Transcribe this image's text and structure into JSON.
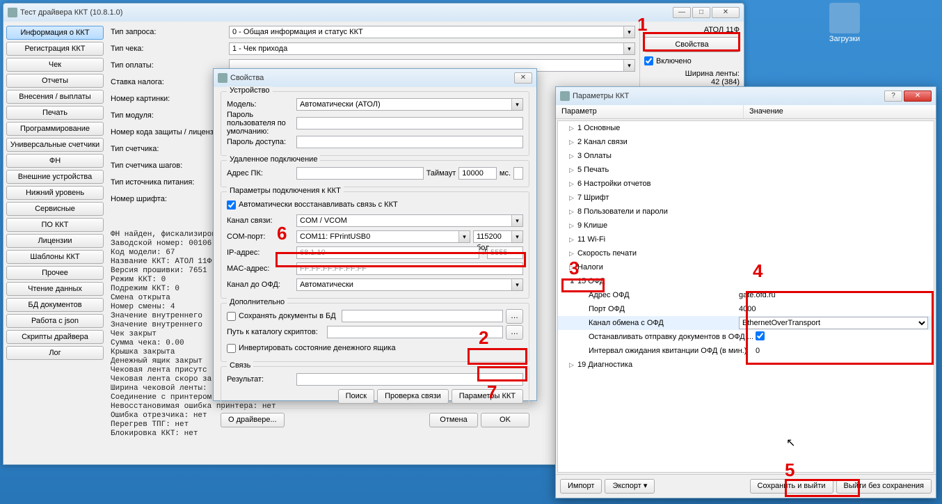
{
  "desktop": {
    "downloads": "Загрузки"
  },
  "main": {
    "title": "Тест драйвера ККТ (10.8.1.0)",
    "sidebar": [
      "Информация о ККТ",
      "Регистрация ККТ",
      "Чек",
      "Отчеты",
      "Внесения / выплаты",
      "Печать",
      "Программирование",
      "Универсальные счетчики",
      "ФН",
      "Внешние устройства",
      "Нижний уровень",
      "Сервисные",
      "ПО ККТ",
      "Лицензии",
      "Шаблоны ККТ",
      "Прочее",
      "Чтение данных",
      "БД документов",
      "Работа с json",
      "Скрипты драйвера",
      "Лог"
    ],
    "fields": {
      "req_type_l": "Тип запроса:",
      "req_type_v": "0 - Общая информация и статус ККТ",
      "rec_type_l": "Тип чека:",
      "rec_type_v": "1 - Чек прихода",
      "pay_type_l": "Тип оплаты:",
      "tax_l": "Ставка налога:",
      "pic_num_l": "Номер картинки:",
      "mod_type_l": "Тип модуля:",
      "lic_l": "Номер кода защиты / лицензии",
      "cnt_type_l": "Тип счетчика:",
      "step_cnt_l": "Тип счетчика шагов:",
      "pwr_l": "Тип источника питания:",
      "font_l": "Номер шрифта:"
    },
    "log": "ФН найден, фискализирован\nЗаводской номер: 00106\nКод модели: 67\nНазвание ККТ: АТОЛ 11Ф\nВерсия прошивки: 7651\nРежим ККТ: 0\nПодрежим ККТ: 0\nСмена открыта\nНомер смены: 4\nЗначение внутреннего\nЗначение внутреннего\nЧек закрыт\nСумма чека: 0.00\nКрышка закрыта\nДенежный ящик закрыт\nЧековая лента присутс\nЧековая лента скоро за\nШирина чековой ленты:\nСоединение с принтером\nНевосстановимая ошибка принтера: нет\nОшибка отрезчика: нет\nПерегрев ТПГ: нет\nБлокировка ККТ: нет",
    "right": {
      "model": "АТОЛ 11Ф",
      "props_btn": "Свойства",
      "enabled": "Включено",
      "tape_l": "Ширина ленты:",
      "tape_v": "42 (384)"
    }
  },
  "dlg1": {
    "title": "Свойства",
    "g_device": "Устройство",
    "model_l": "Модель:",
    "model_v": "Автоматически (АТОЛ)",
    "upwd_l": "Пароль пользователя по умолчанию:",
    "apwd_l": "Пароль доступа:",
    "g_remote": "Удаленное подключение",
    "pc_l": "Адрес ПК:",
    "timeout_l": "Таймаут",
    "timeout_v": "10000",
    "timeout_u": "мс.",
    "g_conn": "Параметры подключения к ККТ",
    "auto_restore": "Автоматически восстанавливать связь с ККТ",
    "chan_l": "Канал связи:",
    "chan_v": "COM / VCOM",
    "com_l": "COM-порт:",
    "com_v": "COM11: FPrintUSB0",
    "baud_v": "115200 бод",
    "ip_l": "IP-адрес:",
    "ip_v": "68.1.10",
    "port_v": "5555",
    "mac_l": "MAC-адрес:",
    "mac_v": "FF:FF:FF:FF:FF:FF",
    "ofd_l": "Канал до ОФД:",
    "ofd_v": "Автоматически",
    "g_extra": "Дополнительно",
    "save_db": "Сохранять документы в БД",
    "script_l": "Путь к каталогу скриптов:",
    "invert": "Инвертировать состояние денежного ящика",
    "g_link": "Связь",
    "result_l": "Результат:",
    "search": "Поиск",
    "check": "Проверка связи",
    "params": "Параметры ККТ",
    "about": "О драйвере...",
    "cancel": "Отмена",
    "ok": "OK"
  },
  "dlg2": {
    "title": "Параметры ККТ",
    "hdr_param": "Параметр",
    "hdr_value": "Значение",
    "nodes": [
      "1 Основные",
      "2 Канал связи",
      "3 Оплаты",
      "5 Печать",
      "6 Настройки отчетов",
      "7 Шрифт",
      "8 Пользователи и пароли",
      "9 Клише",
      "11 Wi-Fi",
      "Скорость печати",
      "Налоги"
    ],
    "node_ofd": "15 ОФД",
    "children": {
      "addr_l": "Адрес ОФД",
      "addr_v": "gate.ofd.ru",
      "port_l": "Порт ОФД",
      "port_v": "4000",
      "chan_l": "Канал обмена с ОФД",
      "chan_v": "EthernetOverTransport",
      "stop_l": "Останавливать отправку документов в ОФД ...",
      "intv_l": "Интервал ожидания квитанции ОФД (в мин.)",
      "intv_v": "0"
    },
    "node_diag": "19 Диагностика",
    "import": "Импорт",
    "export": "Экспорт",
    "save": "Сохранить и выйти",
    "nosave": "Выйти без сохранения"
  },
  "callouts": {
    "n1": "1",
    "n2": "2",
    "n3": "3",
    "n4": "4",
    "n5": "5",
    "n6": "6",
    "n7": "7"
  }
}
